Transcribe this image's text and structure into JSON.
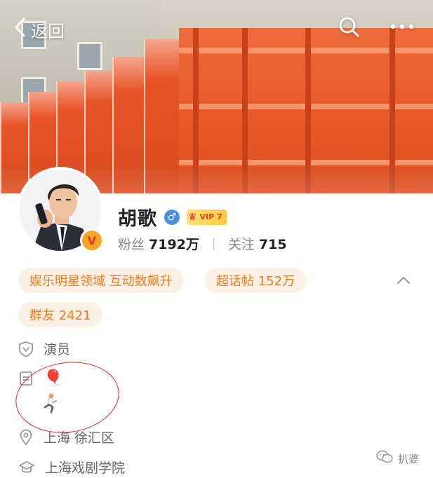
{
  "nav": {
    "back_label": "返回",
    "search_icon": "search-icon",
    "more_icon": "more-icon"
  },
  "profile": {
    "name": "胡歌",
    "gender_symbol": "♂",
    "vip_label": "VIP 7",
    "verified_badge": "V",
    "fans_label": "粉丝",
    "fans_value": "7192万",
    "following_label": "关注",
    "following_value": "715"
  },
  "tags": [
    {
      "label": "娱乐明星领域 互动数飙升"
    },
    {
      "label": "超话帖 152万"
    },
    {
      "label": "群友 2421"
    }
  ],
  "info": {
    "occupation": "演员",
    "bio_emoji": "🎈",
    "bio_emoji_2": "🏃",
    "location": "上海 徐汇区",
    "school": "上海戏剧学院"
  },
  "watermark": {
    "label": "扒婆"
  },
  "colors": {
    "tag_bg": "#fcefe4",
    "tag_text": "#f07d1c",
    "annotation_red": "#e3262a",
    "gender_blue": "#4a90e2",
    "vip_gold": "#ffc93d"
  }
}
